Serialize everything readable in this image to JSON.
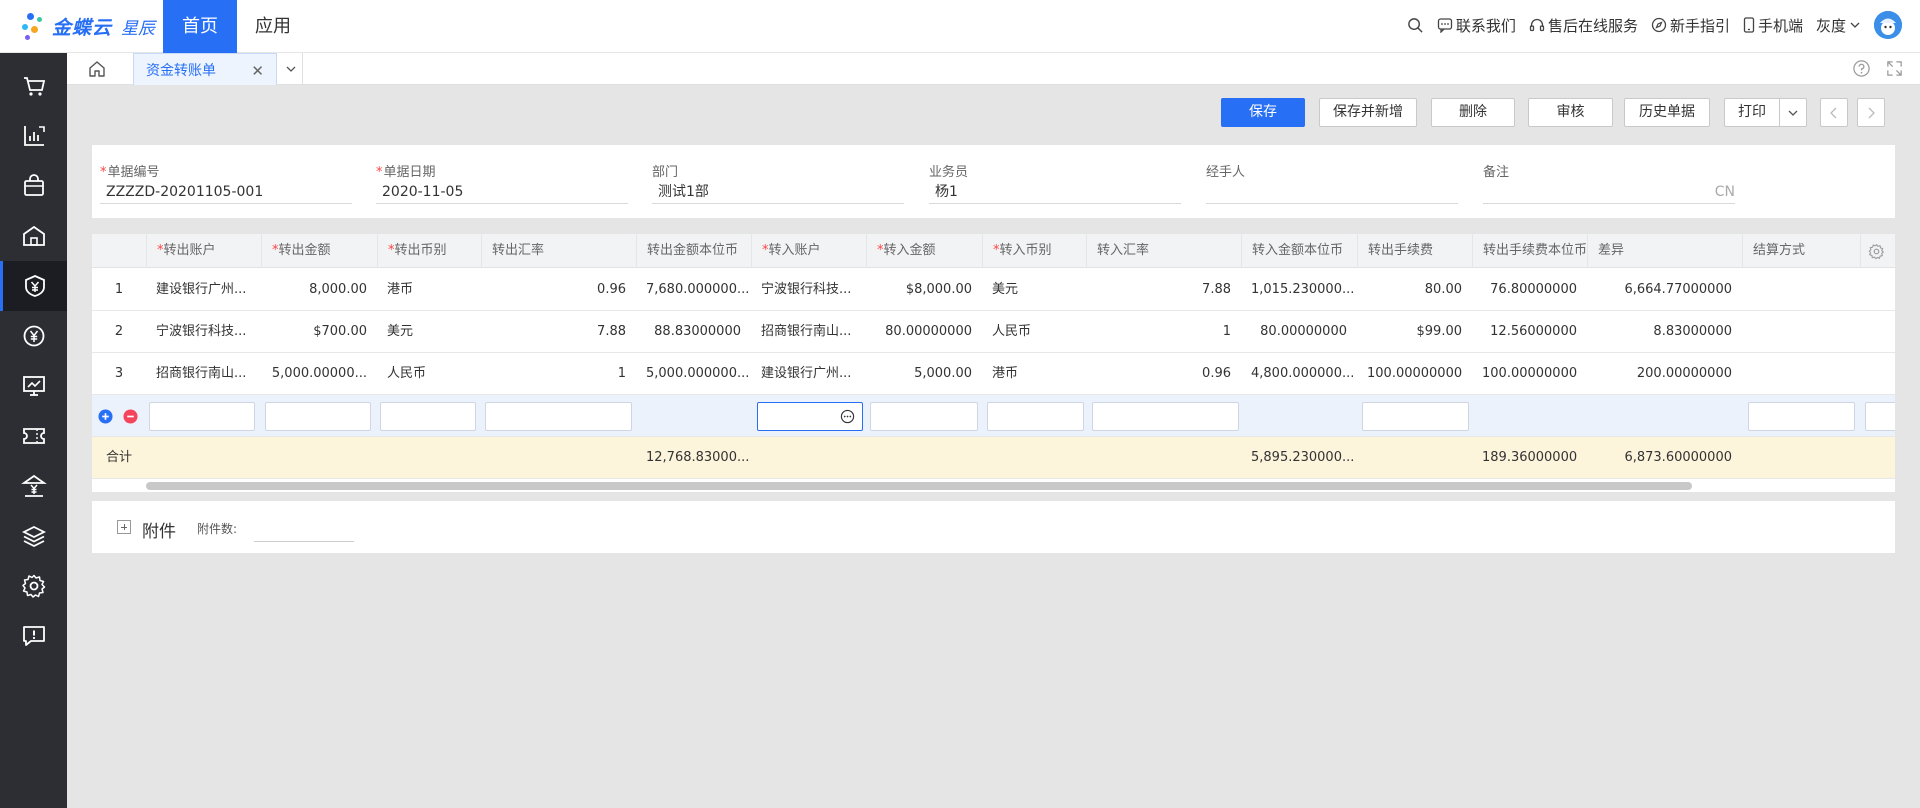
{
  "brand": {
    "name": "金蝶云",
    "sub": "星辰"
  },
  "top_nav": {
    "home": "首页",
    "apps": "应用"
  },
  "top_links": {
    "contact": "联系我们",
    "service": "售后在线服务",
    "guide": "新手指引",
    "mobile": "手机端",
    "user": "灰度"
  },
  "tab": {
    "title": "资金转账单"
  },
  "toolbar": {
    "save": "保存",
    "save_new": "保存并新增",
    "delete": "删除",
    "audit": "审核",
    "history": "历史单据",
    "print": "打印"
  },
  "form": {
    "bill_no_label": "单据编号",
    "bill_no": "ZZZZD-20201105-001",
    "bill_date_label": "单据日期",
    "bill_date": "2020-11-05",
    "dept_label": "部门",
    "dept": "测试1部",
    "salesman_label": "业务员",
    "salesman": "杨1",
    "handler_label": "经手人",
    "handler": "",
    "remark_label": "备注",
    "remark_suffix": "CN"
  },
  "grid": {
    "headers": [
      "转出账户",
      "转出金额",
      "转出币别",
      "转出汇率",
      "转出金额本位币",
      "转入账户",
      "转入金额",
      "转入币别",
      "转入汇率",
      "转入金额本位币",
      "转出手续费",
      "转出手续费本位币",
      "差异",
      "结算方式"
    ],
    "rows": [
      [
        "1",
        "建设银行广州...",
        "8,000.00",
        "港币",
        "0.96",
        "7,680.000000...",
        "宁波银行科技...",
        "$8,000.00",
        "美元",
        "7.88",
        "1,015.230000...",
        "80.00",
        "76.80000000",
        "6,664.77000000",
        ""
      ],
      [
        "2",
        "宁波银行科技...",
        "$700.00",
        "美元",
        "7.88",
        "88.83000000",
        "招商银行南山...",
        "80.00000000",
        "人民币",
        "1",
        "80.00000000",
        "$99.00",
        "12.56000000",
        "8.83000000",
        ""
      ],
      [
        "3",
        "招商银行南山...",
        "5,000.00000...",
        "人民币",
        "1",
        "5,000.000000...",
        "建设银行广州...",
        "5,000.00",
        "港币",
        "0.96",
        "4,800.000000...",
        "100.00000000",
        "100.00000000",
        "200.00000000",
        ""
      ]
    ],
    "total": {
      "label": "合计",
      "out_base": "12,768.83000...",
      "in_base": "5,895.230000...",
      "fee_base": "189.36000000",
      "diff": "6,873.60000000"
    }
  },
  "attachment": {
    "title": "附件",
    "count_label": "附件数:"
  }
}
